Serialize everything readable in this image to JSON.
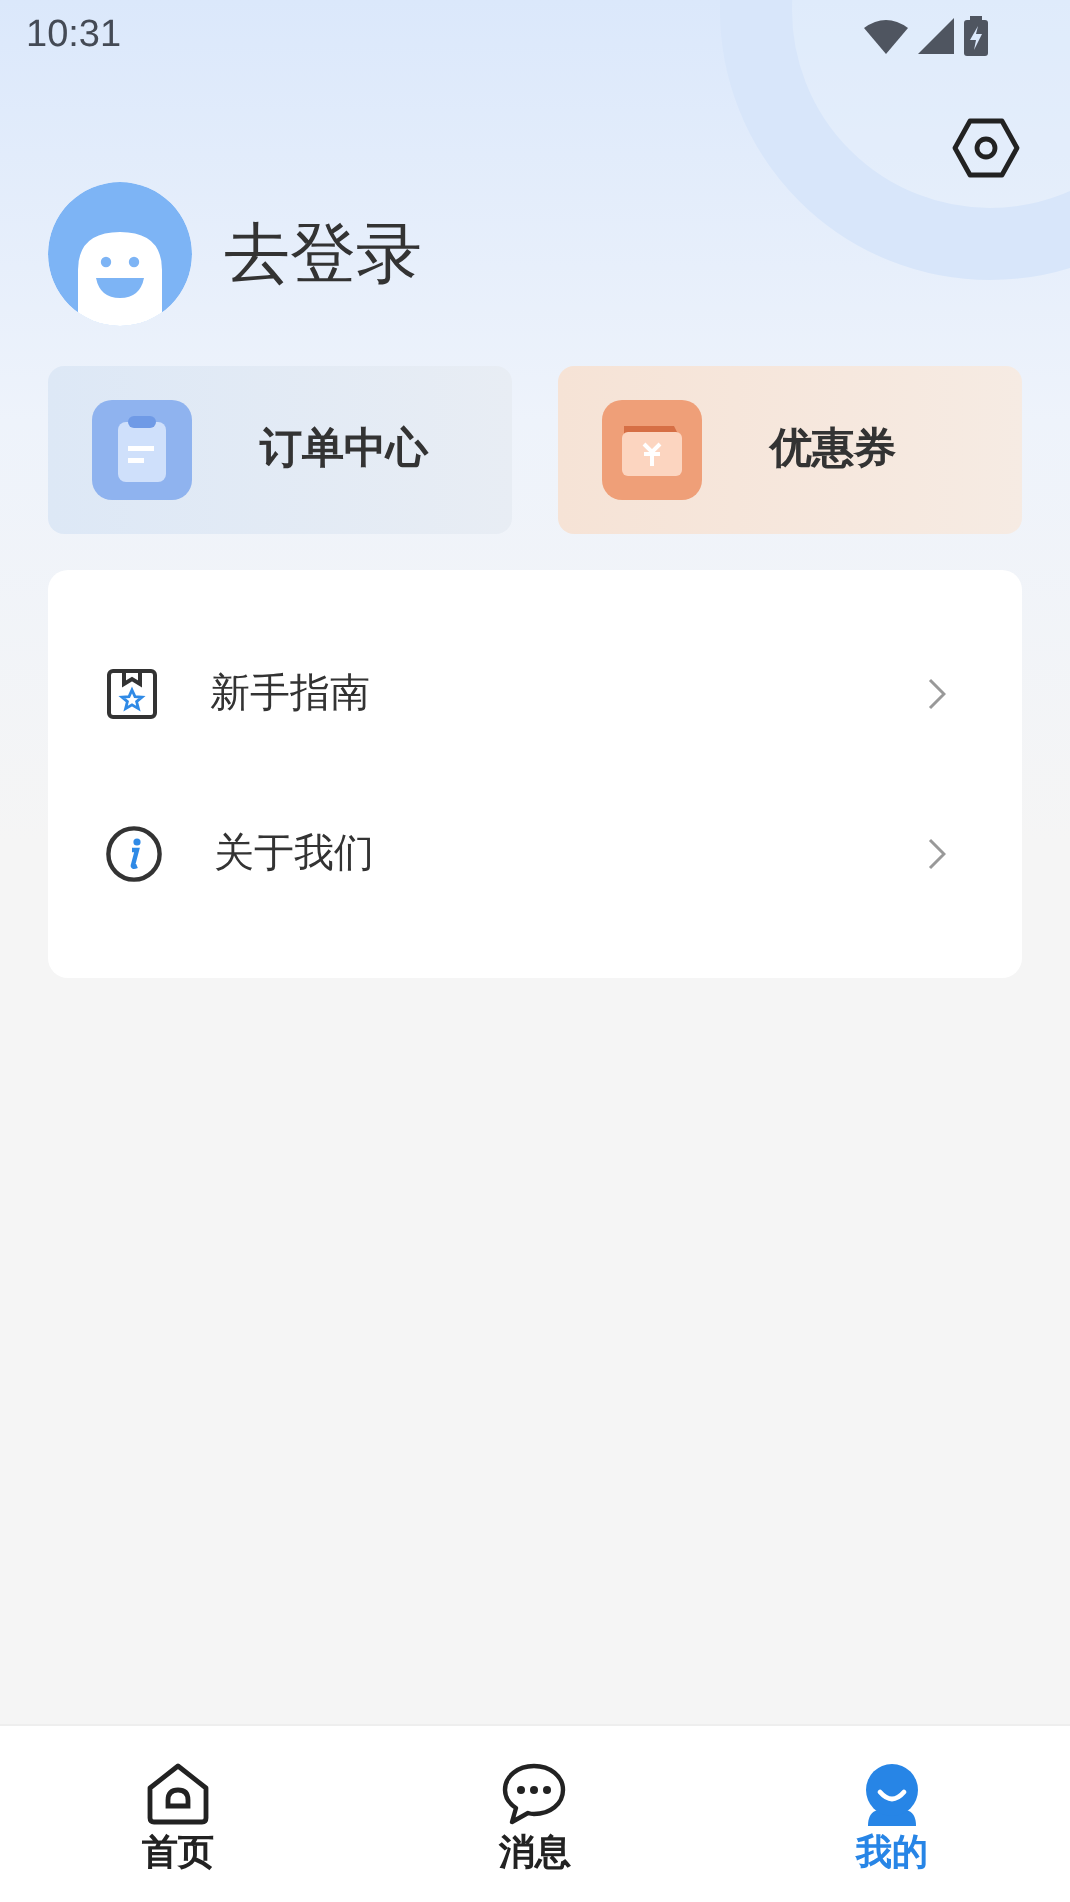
{
  "status_bar": {
    "time": "10:31"
  },
  "profile": {
    "login_label": "去登录"
  },
  "shortcuts": [
    {
      "kind": "orders",
      "label": "订单中心"
    },
    {
      "kind": "coupons",
      "label": "优惠券"
    }
  ],
  "menu": [
    {
      "kind": "guide",
      "label": "新手指南"
    },
    {
      "kind": "about",
      "label": "关于我们"
    }
  ],
  "tabs": [
    {
      "kind": "home",
      "label": "首页",
      "selected": false
    },
    {
      "kind": "messages",
      "label": "消息",
      "selected": false
    },
    {
      "kind": "profile",
      "label": "我的",
      "selected": true
    }
  ]
}
